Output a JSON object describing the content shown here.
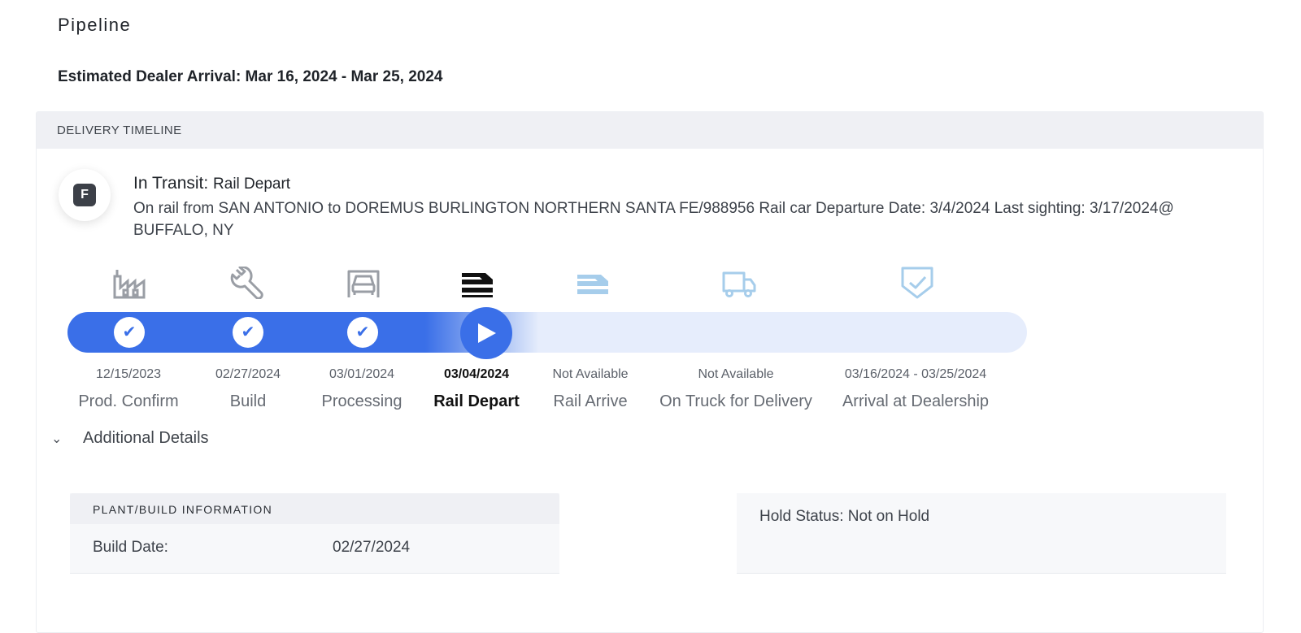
{
  "page": {
    "title": "Pipeline",
    "estimated_arrival": "Estimated Dealer Arrival: Mar 16, 2024 - Mar 25, 2024"
  },
  "timeline": {
    "header": "DELIVERY TIMELINE",
    "badge_letter": "F",
    "status_main": "In Transit:",
    "status_sub": "Rail Depart",
    "description": "On rail from SAN ANTONIO to DOREMUS BURLINGTON NORTHERN SANTA FE/988956 Rail car Departure Date: 3/4/2024 Last sighting: 3/17/2024@ BUFFALO, NY",
    "progress": {
      "completed_steps": 3,
      "current_step": 4,
      "total_steps": 7
    },
    "steps": [
      {
        "date": "12/15/2023",
        "label": "Prod. Confirm",
        "icon": "factory-icon",
        "state": "complete"
      },
      {
        "date": "02/27/2024",
        "label": "Build",
        "icon": "wrench-icon",
        "state": "complete"
      },
      {
        "date": "03/01/2024",
        "label": "Processing",
        "icon": "vehicle-front-icon",
        "state": "complete"
      },
      {
        "date": "03/04/2024",
        "label": "Rail Depart",
        "icon": "rail-car-icon",
        "state": "current"
      },
      {
        "date": "Not Available",
        "label": "Rail Arrive",
        "icon": "rail-car-icon",
        "state": "upcoming"
      },
      {
        "date": "Not Available",
        "label": "On Truck for Delivery",
        "icon": "truck-icon",
        "state": "upcoming"
      },
      {
        "date": "03/16/2024 - 03/25/2024",
        "label": "Arrival at Dealership",
        "icon": "shield-check-icon",
        "state": "upcoming"
      }
    ],
    "check_glyph": "✔",
    "colors": {
      "progress": "#3a6fe8",
      "track": "#e6edfc",
      "complete_icon": "#9a9ea5",
      "upcoming_icon": "#a6cdeb",
      "current_icon": "#111111"
    }
  },
  "details": {
    "toggle_glyph": "⌄",
    "label": "Additional Details",
    "plant_header": "PLANT/BUILD INFORMATION",
    "build_date_label": "Build Date:",
    "build_date_value": "02/27/2024",
    "hold_status": "Hold Status: Not on Hold"
  }
}
